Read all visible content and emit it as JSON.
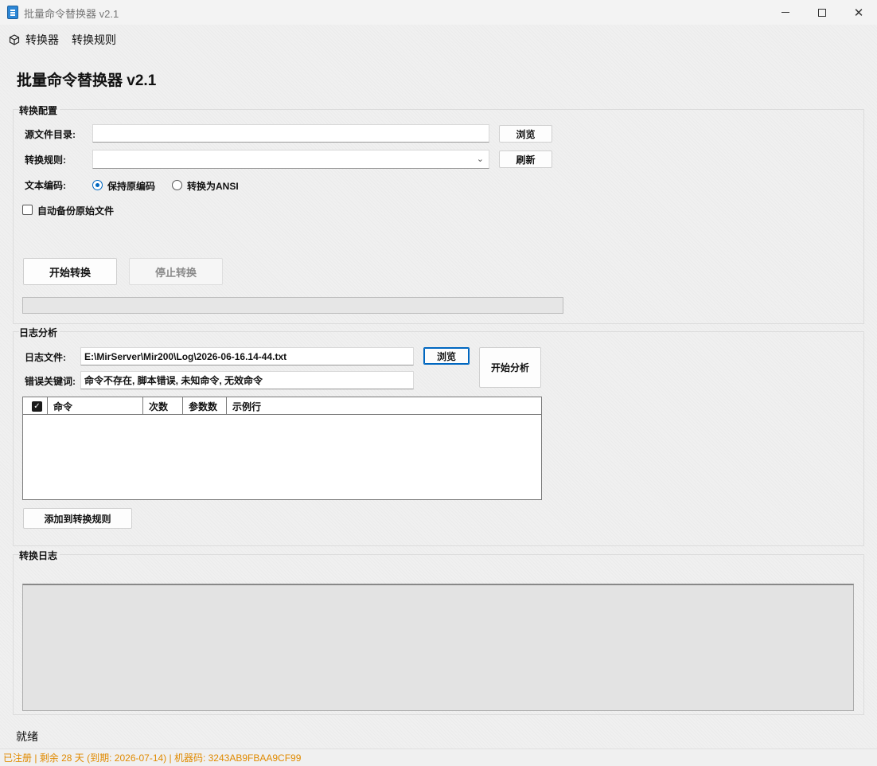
{
  "window": {
    "title": "批量命令替换器 v2.1"
  },
  "menu": {
    "items": [
      {
        "label": "转换器",
        "icon": "cube-icon"
      },
      {
        "label": "转换规则"
      }
    ]
  },
  "app_title": "批量命令替换器 v2.1",
  "convert_config": {
    "group_label": "转换配置",
    "source_dir_label": "源文件目录:",
    "source_dir_value": "",
    "browse_label": "浏览",
    "rule_label": "转换规则:",
    "rule_value": "",
    "refresh_label": "刷新",
    "encoding_label": "文本编码:",
    "encoding_options": [
      "保持原编码",
      "转换为ANSI"
    ],
    "encoding_selected": "保持原编码",
    "backup_label": "自动备份原始文件",
    "backup_checked": false,
    "start_label": "开始转换",
    "stop_label": "停止转换",
    "progress": 0
  },
  "log_analysis": {
    "group_label": "日志分析",
    "log_file_label": "日志文件:",
    "log_file_value": "E:\\MirServer\\Mir200\\Log\\2026-06-16.14-44.txt",
    "browse_label": "浏览",
    "analyze_label": "开始分析",
    "keywords_label": "错误关键词:",
    "keywords_value": "命令不存在, 脚本错误, 未知命令, 无效命令",
    "table": {
      "columns": [
        "命令",
        "次数",
        "参数数",
        "示例行"
      ],
      "rows": []
    },
    "add_rule_label": "添加到转换规则"
  },
  "convert_log": {
    "group_label": "转换日志",
    "content": ""
  },
  "status": {
    "text": "就绪",
    "registration": "已注册 | 剩余 28 天 (到期: 2026-07-14) | 机器码: 3243AB9FBAA9CF99"
  },
  "colors": {
    "accent": "#0067c0",
    "registration_text": "#e08a00"
  }
}
